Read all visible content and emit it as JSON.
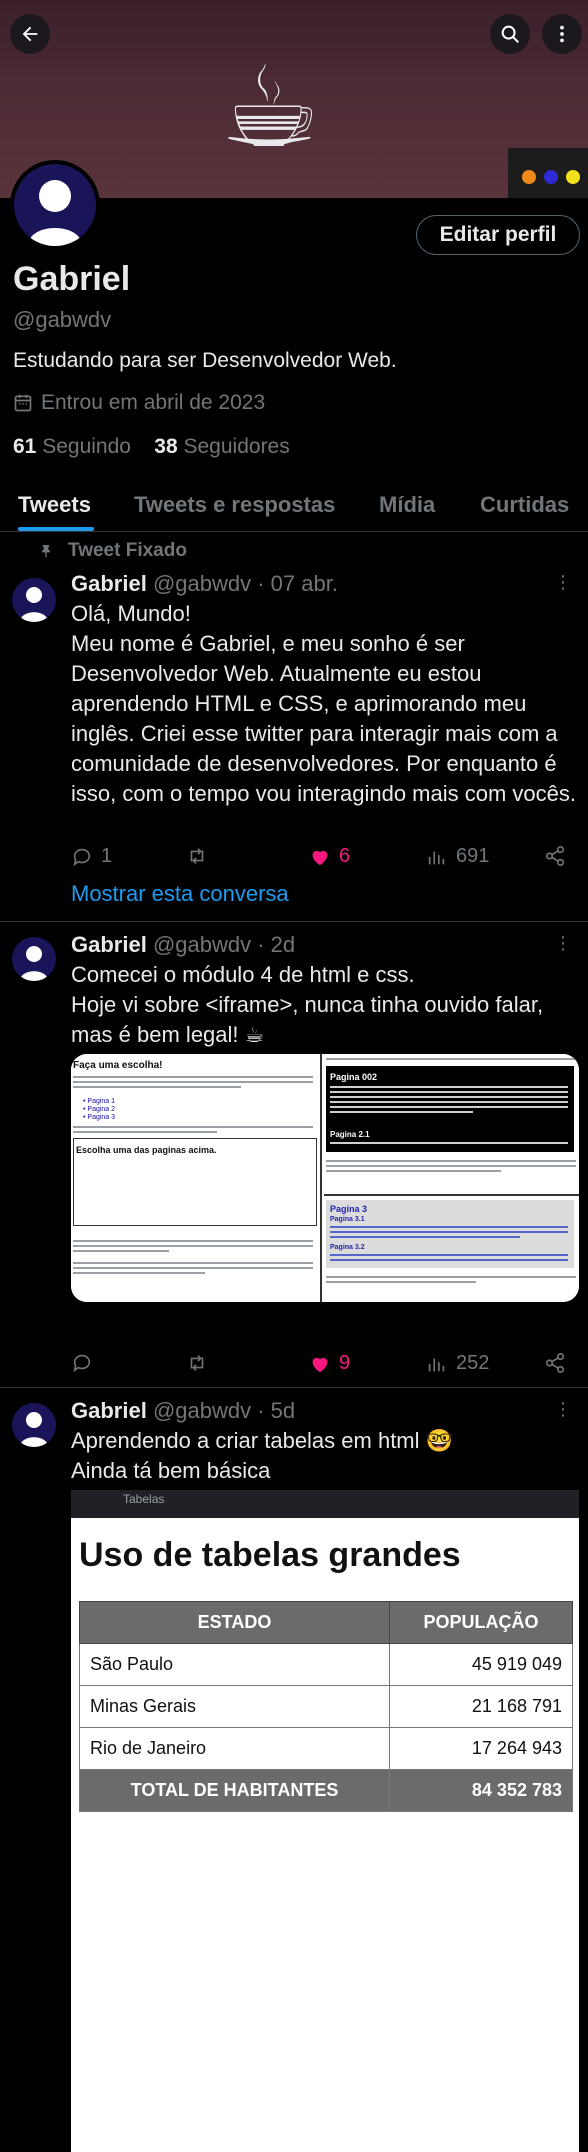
{
  "banner": {
    "emoji": "☕",
    "dot_colors": [
      "#f28a1b",
      "#2d2bd6",
      "#f2e21b"
    ]
  },
  "profile": {
    "name": "Gabriel",
    "handle": "@gabwdv",
    "bio": "Estudando para ser Desenvolvedor Web.",
    "joined": "Entrou em abril de 2023",
    "following_count": "61",
    "following_label": "Seguindo",
    "followers_count": "38",
    "followers_label": "Seguidores",
    "edit_label": "Editar perfil"
  },
  "tabs": [
    "Tweets",
    "Tweets e respostas",
    "Mídia",
    "Curtidas"
  ],
  "pinned_label": "Tweet Fixado",
  "tweets": [
    {
      "name": "Gabriel",
      "meta": "@gabwdv · 07 abr.",
      "text": "Olá, Mundo!\nMeu nome é Gabriel, e meu sonho é ser Desenvolvedor Web. Atualmente eu estou aprendendo HTML e CSS, e aprimorando meu inglês. Criei esse twitter para interagir mais com a comunidade de desenvolvedores. Por enquanto é isso, com o tempo vou interagindo mais com vocês.",
      "replies": "1",
      "retweets": "",
      "likes": "6",
      "views": "691",
      "show_conversation": "Mostrar esta conversa"
    },
    {
      "name": "Gabriel",
      "meta": "@gabwdv · 2d",
      "text": "Comecei o módulo 4 de html e css.\nHoje vi sobre <iframe>, nunca tinha ouvido falar, mas é bem legal! ☕",
      "replies": "",
      "retweets": "",
      "likes": "9",
      "views": "252",
      "media": {
        "left_title": "Faça uma escolha!",
        "left_subtitle": "Escolha uma das paginas acima.",
        "left_links": [
          "Pagina 1",
          "Pagina 2",
          "Pagina 3"
        ],
        "right_top_title": "Pagina 002",
        "right_top_sub": "Pagina 2.1",
        "right_bottom_title": "Pagina 3",
        "right_bottom_sub1": "Pagina 3.1",
        "right_bottom_sub2": "Pagina 3.2"
      }
    },
    {
      "name": "Gabriel",
      "meta": "@gabwdv · 5d",
      "text": "Aprendendo a criar tabelas em html 🤓\nAinda tá bem básica",
      "table_shot": {
        "tab_label": "Tabelas",
        "title": "Uso de tabelas grandes",
        "headers": [
          "ESTADO",
          "POPULAÇÃO"
        ],
        "rows": [
          [
            "São Paulo",
            "45 919 049"
          ],
          [
            "Minas Gerais",
            "21 168 791"
          ],
          [
            "Rio de Janeiro",
            "17 264 943"
          ]
        ],
        "total": [
          "TOTAL DE HABITANTES",
          "84 352 783"
        ]
      }
    }
  ]
}
